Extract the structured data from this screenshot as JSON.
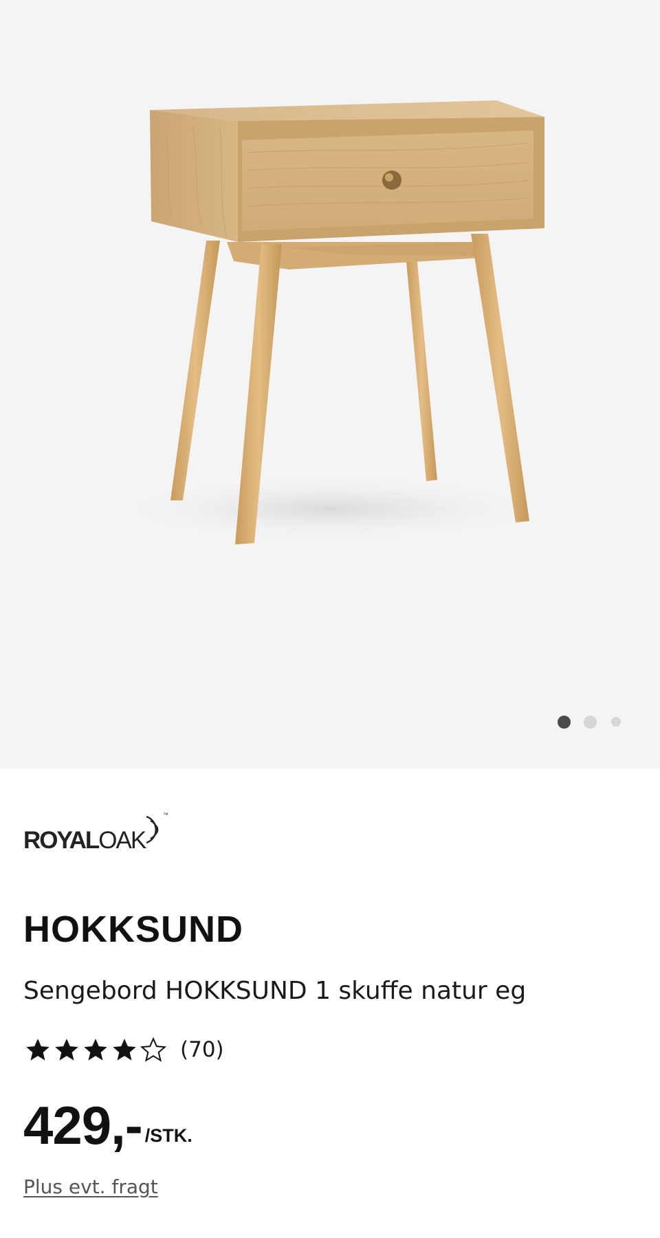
{
  "product": {
    "brand": "ROYAL OAK",
    "brand_part1": "ROYAL",
    "brand_part2": "OAK",
    "brand_tm": "™",
    "name": "HOKKSUND",
    "description": "Sengebord HOKKSUND 1 skuffe natur eg",
    "rating": 4,
    "rating_max": 5,
    "review_count": "(70)",
    "price": "429,-",
    "price_unit": "/STK.",
    "shipping_link": "Plus evt. fragt"
  },
  "gallery": {
    "image_count": 3,
    "active_index": 1,
    "image_subject": "nightstand-image"
  },
  "colors": {
    "hero_bg": "#f5f4f4",
    "wood": "#d9b98a",
    "star": "#111111",
    "dot_active": "#4a4a4a",
    "dot_inactive": "#d6d6d6"
  }
}
